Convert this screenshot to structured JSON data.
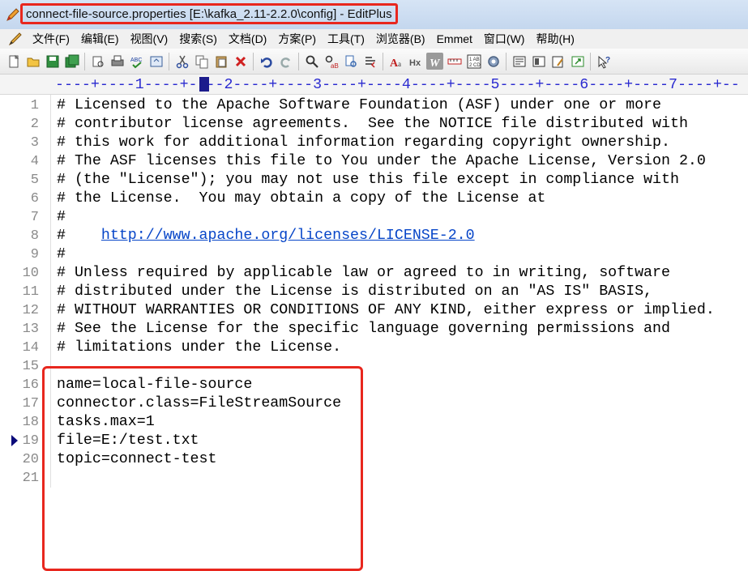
{
  "window": {
    "title": "connect-file-source.properties [E:\\kafka_2.11-2.2.0\\config] - EditPlus",
    "icon": "editplus-pen-icon",
    "title_highlight_color": "#e8271e"
  },
  "menu": {
    "items": [
      "文件(F)",
      "编辑(E)",
      "视图(V)",
      "搜索(S)",
      "文档(D)",
      "方案(P)",
      "工具(T)",
      "浏览器(B)",
      "Emmet",
      "窗口(W)",
      "帮助(H)"
    ]
  },
  "toolbar": {
    "buttons": [
      "new-file-icon",
      "open-file-icon",
      "save-icon",
      "save-all-icon",
      "print-preview-icon",
      "print-icon",
      "spellcheck-icon",
      "browser-preview-icon",
      "cut-icon",
      "copy-icon",
      "paste-icon",
      "delete-icon",
      "undo-icon",
      "redo-icon",
      "find-icon",
      "replace-icon",
      "find-in-files-icon",
      "goto-line-icon",
      "font-icon",
      "hx-icon",
      "word-wrap-icon",
      "ruler-toggle-icon",
      "line-number-icon",
      "settings-icon",
      "cliptext-icon",
      "directory-icon",
      "user-tool-icon",
      "window-icon",
      "help-icon"
    ]
  },
  "ruler": {
    "text": "----+----1----+----2----+----3----+----4----+----5----+----6----+----7----+--"
  },
  "editor": {
    "lines": [
      {
        "n": "1",
        "text": "# Licensed to the Apache Software Foundation (ASF) under one or more"
      },
      {
        "n": "2",
        "text": "# contributor license agreements.  See the NOTICE file distributed with"
      },
      {
        "n": "3",
        "text": "# this work for additional information regarding copyright ownership."
      },
      {
        "n": "4",
        "text": "# The ASF licenses this file to You under the Apache License, Version 2.0"
      },
      {
        "n": "5",
        "text": "# (the \"License\"); you may not use this file except in compliance with"
      },
      {
        "n": "6",
        "text": "# the License.  You may obtain a copy of the License at"
      },
      {
        "n": "7",
        "text": "#"
      },
      {
        "n": "8",
        "text": "#    ",
        "link": "http://www.apache.org/licenses/LICENSE-2.0"
      },
      {
        "n": "9",
        "text": "#"
      },
      {
        "n": "10",
        "text": "# Unless required by applicable law or agreed to in writing, software"
      },
      {
        "n": "11",
        "text": "# distributed under the License is distributed on an \"AS IS\" BASIS,"
      },
      {
        "n": "12",
        "text": "# WITHOUT WARRANTIES OR CONDITIONS OF ANY KIND, either express or implied."
      },
      {
        "n": "13",
        "text": "# See the License for the specific language governing permissions and"
      },
      {
        "n": "14",
        "text": "# limitations under the License."
      },
      {
        "n": "15",
        "text": ""
      },
      {
        "n": "16",
        "text": "name=local-file-source"
      },
      {
        "n": "17",
        "text": "connector.class=FileStreamSource"
      },
      {
        "n": "18",
        "text": "tasks.max=1"
      },
      {
        "n": "19",
        "text": "file=E:/test.txt",
        "current": true
      },
      {
        "n": "20",
        "text": "topic=connect-test"
      },
      {
        "n": "21",
        "text": ""
      }
    ]
  }
}
